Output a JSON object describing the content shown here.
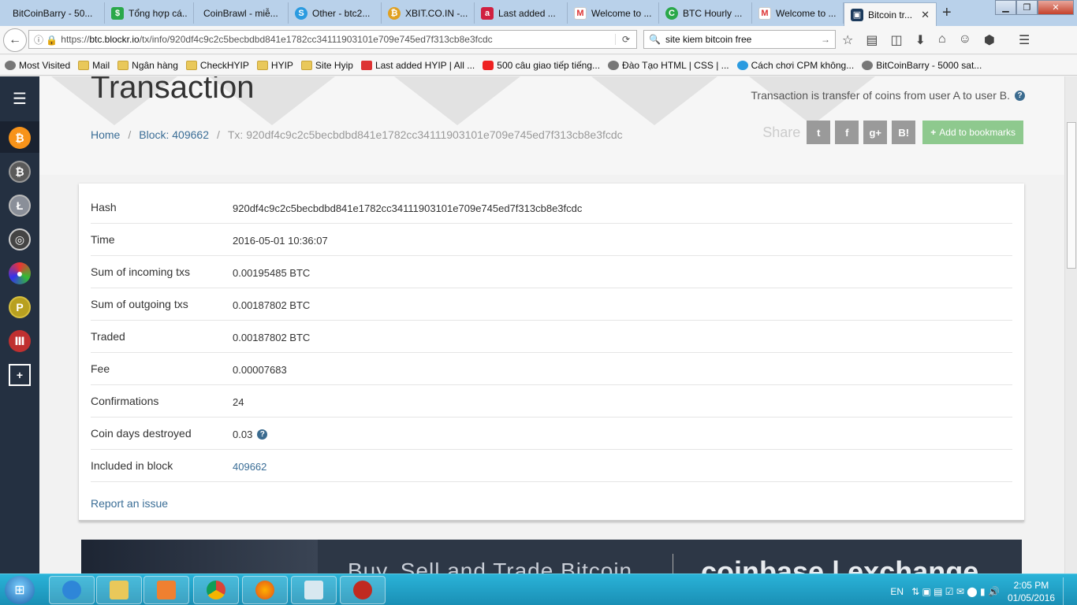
{
  "browser": {
    "tabs": [
      {
        "title": "BitCoinBarry - 50...",
        "icon_color": "#f0a030"
      },
      {
        "title": "Tổng hợp cá...",
        "icon_color": "#2aa84a"
      },
      {
        "title": "CoinBrawl - miễ...",
        "icon_color": ""
      },
      {
        "title": "Other - btc2...",
        "icon_color": "#2b9be0"
      },
      {
        "title": "XBIT.CO.IN -...",
        "icon_color": "#e0a020"
      },
      {
        "title": "Last added ...",
        "icon_color": "#d02040"
      },
      {
        "title": "Welcome to ...",
        "icon_color": "#d33"
      },
      {
        "title": "BTC Hourly ...",
        "icon_color": "#2aa84a"
      },
      {
        "title": "Welcome to ...",
        "icon_color": "#d33"
      },
      {
        "title": "Bitcoin tr...",
        "icon_color": "#1b3a5c"
      }
    ],
    "url_prefix": "https://",
    "url_host": "btc.blockr.io",
    "url_path": "/tx/info/920df4c9c2c5becbdbd841e1782cc34111903101e709e745ed7f313cb8e3fcdc",
    "search_value": "site kiem bitcoin free",
    "bookmarks": [
      {
        "label": "Most Visited",
        "icon": "globe"
      },
      {
        "label": "Mail",
        "icon": "folder"
      },
      {
        "label": "Ngân hàng",
        "icon": "folder"
      },
      {
        "label": "CheckHYIP",
        "icon": "folder"
      },
      {
        "label": "HYIP",
        "icon": "folder"
      },
      {
        "label": "Site Hyip",
        "icon": "folder"
      },
      {
        "label": "Last added HYIP | All ...",
        "icon": "red"
      },
      {
        "label": "500 câu giao tiếp tiếng...",
        "icon": "yt"
      },
      {
        "label": "Đào Tạo HTML | CSS | ...",
        "icon": "globe"
      },
      {
        "label": "Cách chơi CPM không...",
        "icon": "blue"
      },
      {
        "label": "BitCoinBarry - 5000 sat...",
        "icon": "globe"
      }
    ]
  },
  "page": {
    "title": "Transaction",
    "description": "Transaction is transfer of coins from user A to user B.",
    "breadcrumb": {
      "home": "Home",
      "block": "Block: 409662",
      "tx": "Tx: 920df4c9c2c5becbdbd841e1782cc34111903101e709e745ed7f313cb8e3fcdc"
    },
    "share_label": "Share",
    "share_buttons": [
      "t",
      "f",
      "g+",
      "B!"
    ],
    "bookmark_button": "Add to bookmarks",
    "details": [
      {
        "label": "Hash",
        "value": "920df4c9c2c5becbdbd841e1782cc34111903101e709e745ed7f313cb8e3fcdc"
      },
      {
        "label": "Time",
        "value": "2016-05-01 10:36:07"
      },
      {
        "label": "Sum of incoming txs",
        "value": "0.00195485 BTC"
      },
      {
        "label": "Sum of outgoing txs",
        "value": "0.00187802 BTC"
      },
      {
        "label": "Traded",
        "value": "0.00187802 BTC"
      },
      {
        "label": "Fee",
        "value": "0.00007683"
      },
      {
        "label": "Confirmations",
        "value": "24"
      },
      {
        "label": "Coin days destroyed",
        "value": "0.03"
      },
      {
        "label": "Included in block",
        "value": "409662"
      }
    ],
    "report_link": "Report an issue",
    "banner_text": "Buy, Sell and Trade Bitcoin",
    "banner_logo": "coinbase | exchange"
  },
  "taskbar": {
    "lang": "EN",
    "time": "2:05 PM",
    "date": "01/05/2016"
  },
  "colors": {
    "sidebar_bg": "#243041",
    "link": "#3a6d96",
    "bookmark_btn": "#8ec98e",
    "bitcoin_orange": "#f7931a"
  }
}
